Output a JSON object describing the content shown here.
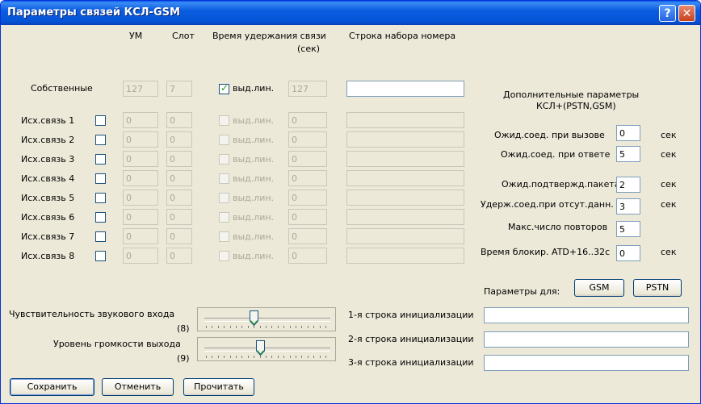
{
  "window": {
    "title": "Параметры связей КСЛ-GSM"
  },
  "columns": {
    "um": "УМ",
    "slot": "Слот",
    "hold_line1": "Время удержания связи",
    "hold_line2": "(сек)",
    "dial": "Строка набора номера"
  },
  "own": {
    "label": "Собственные",
    "um": "127",
    "slot": "7",
    "check_label": "выд.лин.",
    "checked": true,
    "hold": "127",
    "dial": ""
  },
  "links": [
    {
      "label": "Исх.связь 1",
      "um": "0",
      "slot": "0",
      "check_label": "выд.лин.",
      "hold": "0"
    },
    {
      "label": "Исх.связь 2",
      "um": "0",
      "slot": "0",
      "check_label": "выд.лин.",
      "hold": "0"
    },
    {
      "label": "Исх.связь 3",
      "um": "0",
      "slot": "0",
      "check_label": "выд.лин.",
      "hold": "0"
    },
    {
      "label": "Исх.связь 4",
      "um": "0",
      "slot": "0",
      "check_label": "выд.лин.",
      "hold": "0"
    },
    {
      "label": "Исх.связь 5",
      "um": "0",
      "slot": "0",
      "check_label": "выд.лин.",
      "hold": "0"
    },
    {
      "label": "Исх.связь 6",
      "um": "0",
      "slot": "0",
      "check_label": "выд.лин.",
      "hold": "0"
    },
    {
      "label": "Исх.связь 7",
      "um": "0",
      "slot": "0",
      "check_label": "выд.лин.",
      "hold": "0"
    },
    {
      "label": "Исх.связь 8",
      "um": "0",
      "slot": "0",
      "check_label": "выд.лин.",
      "hold": "0"
    }
  ],
  "extra": {
    "title_line1": "Дополнительные параметры",
    "title_line2": "КСЛ+(PSTN,GSM)",
    "unit": "сек",
    "params": [
      {
        "label": "Ожид.соед. при вызове",
        "value": "0"
      },
      {
        "label": "Ожид.соед. при ответе",
        "value": "5"
      },
      {
        "label": "Ожид.подтвержд.пакета",
        "value": "2"
      },
      {
        "label": "Удерж.соед.при отсут.данн.",
        "value": "3"
      },
      {
        "label": "Макс.число повторов",
        "value": "5"
      },
      {
        "label": "Время блокир. ATD+16..32с",
        "value": "0"
      }
    ],
    "params_for": "Параметры для:",
    "gsm": "GSM",
    "pstn": "PSTN"
  },
  "sliders": [
    {
      "label": "Чувствительность звукового входа",
      "value_text": "(8)",
      "value": 8,
      "max": 20
    },
    {
      "label": "Уровень громкости выхода",
      "value_text": "(9)",
      "value": 9,
      "max": 20
    }
  ],
  "init": [
    {
      "label": "1-я строка инициализации",
      "value": ""
    },
    {
      "label": "2-я строка инициализации",
      "value": ""
    },
    {
      "label": "3-я строка инициализации",
      "value": ""
    }
  ],
  "buttons": {
    "save": "Сохранить",
    "cancel": "Отменить",
    "read": "Прочитать"
  }
}
